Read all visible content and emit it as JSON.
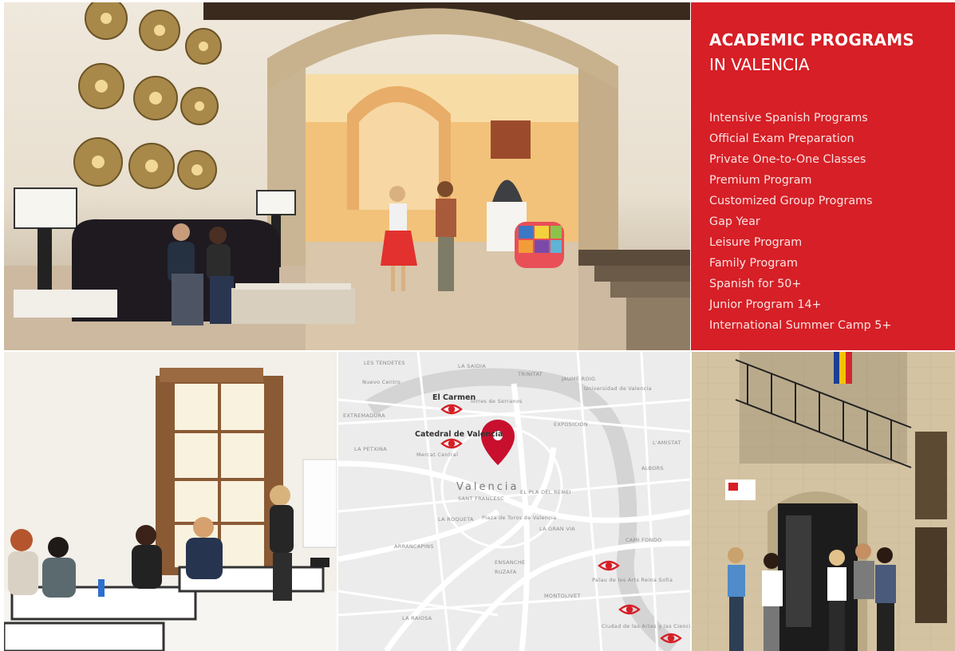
{
  "programs": {
    "title": "ACADEMIC PROGRAMS",
    "subtitle": "IN VALENCIA",
    "items": [
      "Intensive Spanish Programs",
      "Official Exam Preparation",
      "Private One-to-One Classes",
      "Premium Program",
      "Customized Group Programs",
      "Gap Year",
      "Leisure Program",
      "Family Program",
      "Spanish for 50+",
      "Junior Program 14+",
      "International Summer Camp 5+"
    ],
    "panel_color": "#d61f26"
  },
  "map": {
    "places": {
      "el_carmen": "El Carmen",
      "catedral": "Catedral de Valencia",
      "city": "Valencia"
    },
    "districts": {
      "nuevo_centro": "Nuevo Centro",
      "torres_serranos": "Torres de Serranos",
      "universidad": "Universidad de Valencia",
      "mercat": "Mercat Central",
      "sant_francesc": "SANT FRANCESC",
      "el_pla_remei": "EL PLA DEL REMEI",
      "la_roqueta": "LA ROQUETA",
      "plaza_toros": "Plaza de Toros de Valencia",
      "la_gran_via": "LA GRAN VIA",
      "ensanche": "ENSANCHE",
      "ruzafa": "RUZAFA",
      "la_petxina": "LA PETXINA",
      "exposicion": "EXPOSICIÓN",
      "jaume_roig": "JAUME ROIG",
      "trinitat": "TRINITAT",
      "albors": "ALBORS",
      "lamistat": "L'AMISTAT",
      "camino_fondo": "CAMI FONDO",
      "palau_arts": "Palau de les Arts Reina Sofia",
      "ciudad_artes": "Ciudad de las Artes y las Ciencias",
      "arrancapins": "ARRANCAPINS",
      "la_raiosa": "LA RAIOSA",
      "montolivet": "MONTOLIVET",
      "la_saidia": "LA SAIDIA",
      "tendetes": "LES TENDETES",
      "extremadura": "EXTREMADURA"
    },
    "marker_color": "#d61f26"
  },
  "icons": {
    "location_pin": "location-pin-icon",
    "eye": "eye-icon"
  }
}
